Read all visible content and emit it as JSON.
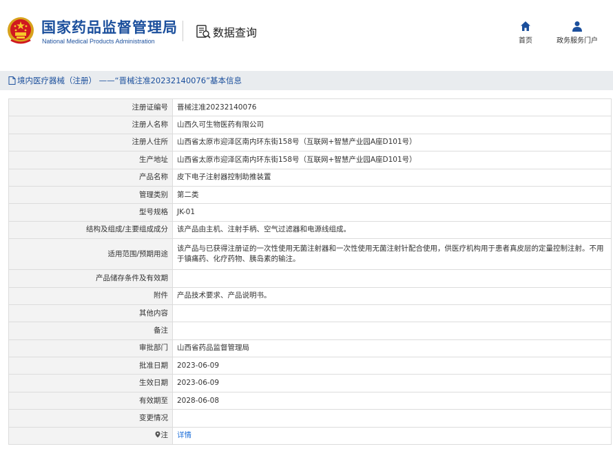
{
  "header": {
    "org_cn": "国家药品监督管理局",
    "org_en": "National Medical Products Administration",
    "query_label": "数据查询",
    "nav_home": "首页",
    "nav_gov": "政务服务门户"
  },
  "colors": {
    "brand": "#1b4f9c",
    "link": "#1e6fd9",
    "label_bg": "#f3f3f3",
    "titlebar_bg": "#e9ecef"
  },
  "title": "境内医疗器械（注册） ——“晋械注准20232140076”基本信息",
  "rows": [
    {
      "label": "注册证编号",
      "value": "晋械注准20232140076"
    },
    {
      "label": "注册人名称",
      "value": "山西久可生物医药有限公司"
    },
    {
      "label": "注册人住所",
      "value": "山西省太原市迎泽区南内环东街158号（互联网+智慧产业园A座D101号）"
    },
    {
      "label": "生产地址",
      "value": "山西省太原市迎泽区南内环东街158号（互联网+智慧产业园A座D101号）"
    },
    {
      "label": "产品名称",
      "value": "皮下电子注射器控制助推装置"
    },
    {
      "label": "管理类别",
      "value": "第二类"
    },
    {
      "label": "型号规格",
      "value": "JK-01"
    },
    {
      "label": "结构及组成/主要组成成分",
      "value": "该产品由主机、注射手柄、空气过滤器和电源线组成。"
    },
    {
      "label": "适用范围/预期用途",
      "value": "该产品与已获得注册证的一次性使用无菌注射器和一次性使用无菌注射针配合使用，供医疗机构用于患者真皮层的定量控制注射。不用于镇痛药、化疗药物、胰岛素的输注。"
    },
    {
      "label": "产品储存条件及有效期",
      "value": ""
    },
    {
      "label": "附件",
      "value": "产品技术要求、产品说明书。"
    },
    {
      "label": "其他内容",
      "value": ""
    },
    {
      "label": "备注",
      "value": ""
    },
    {
      "label": "审批部门",
      "value": "山西省药品监督管理局"
    },
    {
      "label": "批准日期",
      "value": "2023-06-09"
    },
    {
      "label": "生效日期",
      "value": "2023-06-09"
    },
    {
      "label": "有效期至",
      "value": "2028-06-08"
    },
    {
      "label": "变更情况",
      "value": ""
    },
    {
      "label": "注",
      "value": "详情"
    }
  ]
}
